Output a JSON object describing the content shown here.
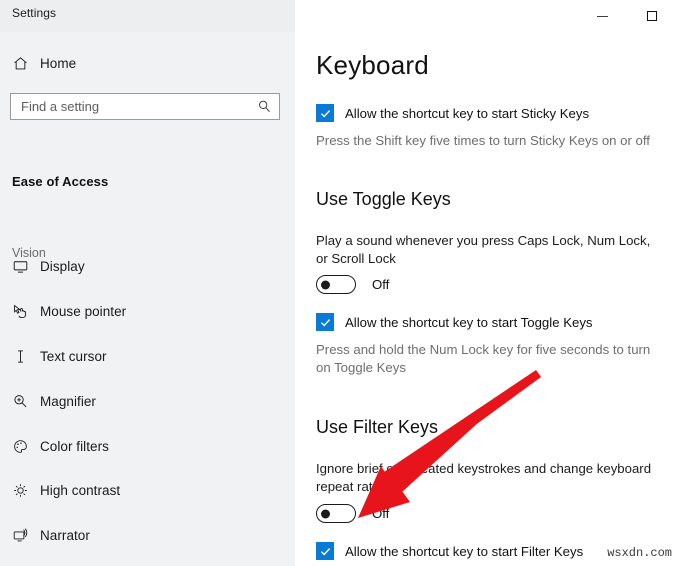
{
  "window": {
    "title": "Settings",
    "minimize_label": "Minimize",
    "maximize_label": "Maximize"
  },
  "sidebar": {
    "home": {
      "label": "Home",
      "icon": "home-icon"
    },
    "search": {
      "value": "",
      "placeholder": "Find a setting",
      "icon": "search-icon"
    },
    "section_title": "Ease of Access",
    "group_label": "Vision",
    "items": [
      {
        "label": "Display",
        "icon": "monitor-icon"
      },
      {
        "label": "Mouse pointer",
        "icon": "cursor-hand-icon"
      },
      {
        "label": "Text cursor",
        "icon": "text-cursor-icon"
      },
      {
        "label": "Magnifier",
        "icon": "magnifier-plus-icon"
      },
      {
        "label": "Color filters",
        "icon": "palette-icon"
      },
      {
        "label": "High contrast",
        "icon": "brightness-icon"
      },
      {
        "label": "Narrator",
        "icon": "narrator-icon"
      }
    ]
  },
  "main": {
    "page_title": "Keyboard",
    "sticky_keys": {
      "checkbox_label": "Allow the shortcut key to start Sticky Keys",
      "checkbox_checked": "true",
      "hint": "Press the Shift key five times to turn Sticky Keys on or off"
    },
    "toggle_keys": {
      "heading": "Use Toggle Keys",
      "description": "Play a sound whenever you press Caps Lock, Num Lock, or Scroll Lock",
      "toggle_state": "Off",
      "checkbox_label": "Allow the shortcut key to start Toggle Keys",
      "checkbox_checked": "true",
      "hint": "Press and hold the Num Lock key for five seconds to turn on Toggle Keys"
    },
    "filter_keys": {
      "heading": "Use Filter Keys",
      "description": "Ignore brief or repeated keystrokes and change keyboard repeat rates",
      "toggle_state": "Off",
      "checkbox_label": "Allow the shortcut key to start Filter Keys",
      "checkbox_checked": "true"
    }
  },
  "annotation": {
    "arrow_color": "#E8141B",
    "arrow_points_to": "filter-keys-toggle"
  },
  "watermark": {
    "text": "wsxdn.com"
  },
  "colors": {
    "accent_checkbox": "#0A7AD6",
    "sidebar_bg": "#F1F2F4",
    "main_bg": "#FFFFFF",
    "arrow_red": "#E8141B"
  }
}
